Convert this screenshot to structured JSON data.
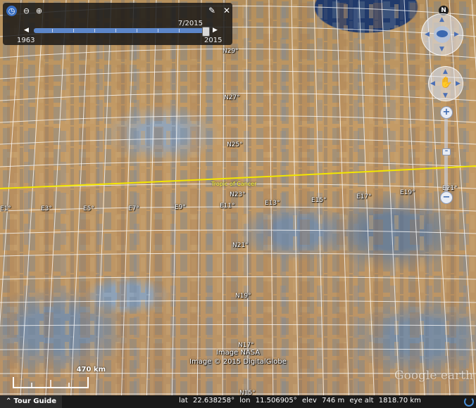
{
  "timeline": {
    "current_date": "7/2015",
    "start_year": "1963",
    "end_year": "2015",
    "clock_icon": "clock-icon",
    "zoom_out_icon": "zoom-out-icon",
    "zoom_in_icon": "zoom-in-icon",
    "settings_icon": "wrench-icon",
    "close_icon": "close-icon"
  },
  "navigation": {
    "north_label": "N"
  },
  "grid_labels": {
    "latitudes": [
      "N27°",
      "N25°",
      "N23°",
      "N21°",
      "N19°",
      "N17°",
      "N15°"
    ],
    "lat_top": "N29°",
    "longitudes": [
      "E1°",
      "E3°",
      "E5°",
      "E7°",
      "E9°",
      "E11°",
      "E13°",
      "E15°",
      "E17°",
      "E19°",
      "E21°"
    ]
  },
  "tropic_label": "Tropic of Cancer",
  "attribution": {
    "line1": "Image NASA",
    "line2": "Image © 2015 DigitalGlobe"
  },
  "scale": {
    "label": "470 km"
  },
  "logo": "Google earth",
  "statusbar": {
    "tour_guide": "Tour Guide",
    "lat_label": "lat",
    "lat_value": "22.638258°",
    "lon_label": "lon",
    "lon_value": "11.506905°",
    "elev_label": "elev",
    "elev_value": "746 m",
    "eyealt_label": "eye alt",
    "eyealt_value": "1818.70 km"
  },
  "colors": {
    "tropic_line": "#f2e600",
    "grid_line": "#ffffff",
    "timeline_track": "#5c86c9"
  }
}
